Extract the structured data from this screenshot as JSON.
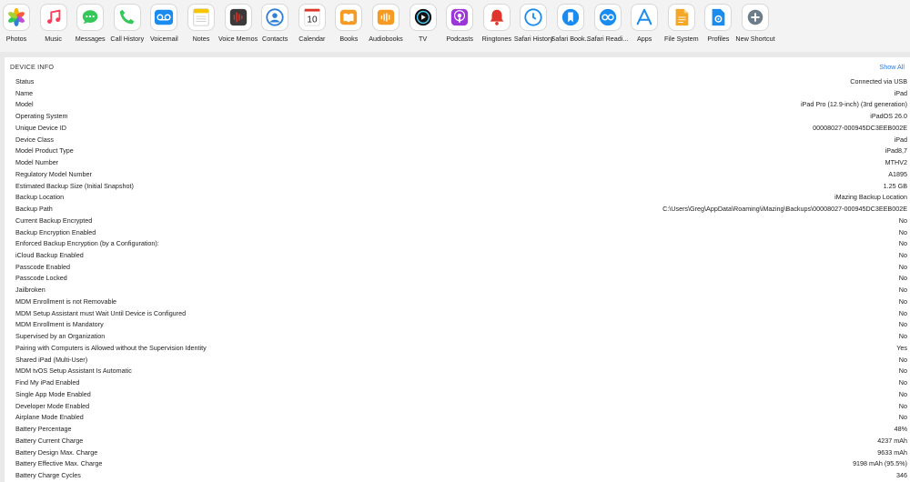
{
  "toolbar": {
    "items": [
      {
        "label": "Photos",
        "icon": "photos-icon",
        "color": "#f4b400"
      },
      {
        "label": "Music",
        "icon": "music-icon",
        "color": "#fa3c5a"
      },
      {
        "label": "Messages",
        "icon": "messages-icon",
        "color": "#34c759"
      },
      {
        "label": "Call History",
        "icon": "phone-icon",
        "color": "#34c759"
      },
      {
        "label": "Voicemail",
        "icon": "voicemail-icon",
        "color": "#1a8cf0"
      },
      {
        "label": "Notes",
        "icon": "notes-icon",
        "color": "#f7c600"
      },
      {
        "label": "Voice Memos",
        "icon": "voice-memos-icon",
        "color": "#444444"
      },
      {
        "label": "Contacts",
        "icon": "contacts-icon",
        "color": "#2f7fd6"
      },
      {
        "label": "Calendar",
        "icon": "calendar-icon",
        "color": "#e0352b",
        "text": "10"
      },
      {
        "label": "Books",
        "icon": "books-icon",
        "color": "#f59a23"
      },
      {
        "label": "Audiobooks",
        "icon": "audiobooks-icon",
        "color": "#f59a23"
      },
      {
        "label": "TV",
        "icon": "tv-icon",
        "color": "#111111"
      },
      {
        "label": "Podcasts",
        "icon": "podcasts-icon",
        "color": "#9b37d6"
      },
      {
        "label": "Ringtones",
        "icon": "bell-icon",
        "color": "#e0352b"
      },
      {
        "label": "Safari History",
        "icon": "safari-history-icon",
        "color": "#1a8cf0"
      },
      {
        "label": "Safari Book...",
        "icon": "safari-bookmarks-icon",
        "color": "#1a8cf0"
      },
      {
        "label": "Safari Readi...",
        "icon": "safari-reading-icon",
        "color": "#1a8cf0"
      },
      {
        "label": "Apps",
        "icon": "apps-icon",
        "color": "#1a8cf0"
      },
      {
        "label": "File System",
        "icon": "file-icon",
        "color": "#f5a623"
      },
      {
        "label": "Profiles",
        "icon": "profiles-icon",
        "color": "#1a8cf0"
      },
      {
        "label": "New Shortcut",
        "icon": "plus-icon",
        "color": "#6b7c8a"
      }
    ]
  },
  "device_info": {
    "title": "DEVICE INFO",
    "show_all": "Show All",
    "rows": [
      {
        "key": "Status",
        "value": "Connected via USB"
      },
      {
        "key": "Name",
        "value": "iPad"
      },
      {
        "key": "Model",
        "value": "iPad Pro (12.9-inch) (3rd generation)"
      },
      {
        "key": "Operating System",
        "value": "iPadOS 26.0"
      },
      {
        "key": "Unique Device ID",
        "value": "00008027-000945DC3EEB002E"
      },
      {
        "key": "Device Class",
        "value": "iPad"
      },
      {
        "key": "Model Product Type",
        "value": "iPad8,7"
      },
      {
        "key": "Model Number",
        "value": "MTHV2"
      },
      {
        "key": "Regulatory Model Number",
        "value": "A1895"
      },
      {
        "key": "Estimated Backup Size (Initial Snapshot)",
        "value": "1.25 GB"
      },
      {
        "key": "Backup Location",
        "value": "iMazing Backup Location"
      },
      {
        "key": "Backup Path",
        "value": "C:\\Users\\Greg\\AppData\\Roaming\\iMazing\\Backups\\00008027-000945DC3EEB002E"
      },
      {
        "key": "Current Backup Encrypted",
        "value": "No"
      },
      {
        "key": "Backup Encryption Enabled",
        "value": "No"
      },
      {
        "key": "Enforced Backup Encryption (by a Configuration):",
        "value": "No"
      },
      {
        "key": "iCloud Backup Enabled",
        "value": "No"
      },
      {
        "key": "Passcode Enabled",
        "value": "No"
      },
      {
        "key": "Passcode Locked",
        "value": "No"
      },
      {
        "key": "Jailbroken",
        "value": "No"
      },
      {
        "key": "MDM Enrollment is not Removable",
        "value": "No"
      },
      {
        "key": "MDM Setup Assistant must Wait Until Device is Configured",
        "value": "No"
      },
      {
        "key": "MDM Enrollment is Mandatory",
        "value": "No"
      },
      {
        "key": "Supervised by an Organization",
        "value": "No"
      },
      {
        "key": "Pairing with Computers is Allowed without the Supervision Identity",
        "value": "Yes"
      },
      {
        "key": "Shared iPad (Multi-User)",
        "value": "No"
      },
      {
        "key": "MDM tvOS Setup Assistant Is Automatic",
        "value": "No"
      },
      {
        "key": "Find My iPad Enabled",
        "value": "No"
      },
      {
        "key": "Single App Mode Enabled",
        "value": "No"
      },
      {
        "key": "Developer Mode Enabled",
        "value": "No"
      },
      {
        "key": "Airplane Mode Enabled",
        "value": "No"
      },
      {
        "key": "Battery Percentage",
        "value": "48%"
      },
      {
        "key": "Battery Current Charge",
        "value": "4237 mAh"
      },
      {
        "key": "Battery Design Max. Charge",
        "value": "9633 mAh"
      },
      {
        "key": "Battery Effective Max. Charge",
        "value": "9198 mAh (95.5%)"
      },
      {
        "key": "Battery Charge Cycles",
        "value": "346"
      }
    ]
  }
}
